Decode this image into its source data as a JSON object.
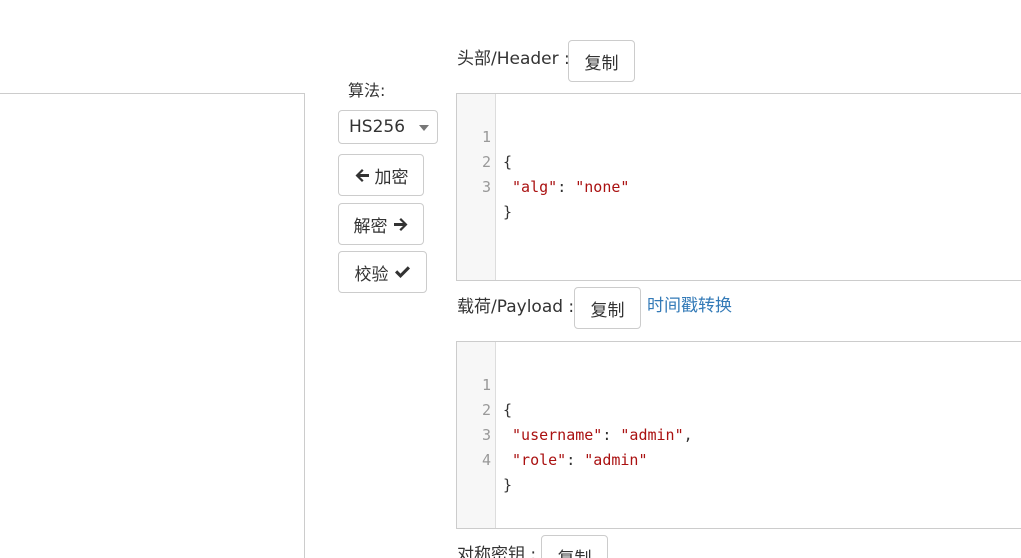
{
  "token_input": {
    "value": ""
  },
  "algorithm": {
    "label": "算法:",
    "selected": "HS256"
  },
  "actions": {
    "encrypt_label": "加密",
    "decrypt_label": "解密",
    "verify_label": "校验"
  },
  "header_section": {
    "label": "头部/Header :",
    "copy_label": "复制",
    "lines": [
      {
        "num": "1",
        "text": "{"
      },
      {
        "num": "2",
        "key": " \"alg\"",
        "sep": ": ",
        "val": "\"none\""
      },
      {
        "num": "3",
        "text": "}"
      }
    ]
  },
  "payload_section": {
    "label": "载荷/Payload :",
    "copy_label": "复制",
    "timestamp_link": "时间戳转换",
    "lines": [
      {
        "num": "1",
        "text": "{"
      },
      {
        "num": "2",
        "key": " \"username\"",
        "sep": ": ",
        "val": "\"admin\"",
        "tail": ","
      },
      {
        "num": "3",
        "key": " \"role\"",
        "sep": ": ",
        "val": "\"admin\""
      },
      {
        "num": "4",
        "text": "}"
      }
    ]
  },
  "secret_section": {
    "label": "对称密钥 :",
    "copy_label": "复制"
  },
  "colors": {
    "link": "#337ab7",
    "string": "#aa1111",
    "border": "#cccccc"
  }
}
